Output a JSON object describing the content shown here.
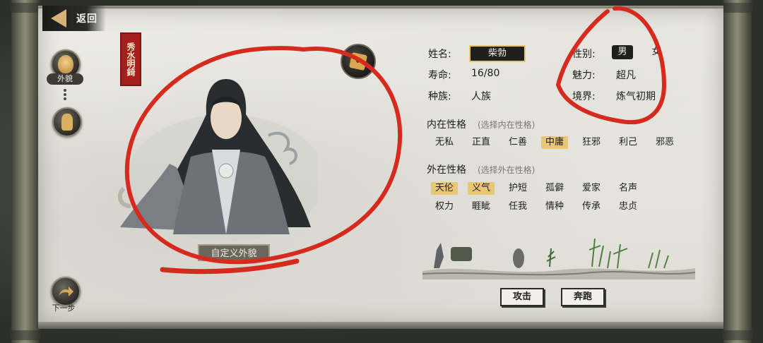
{
  "nav": {
    "back_label": "返回"
  },
  "left_panel": {
    "appearance_label": "外貌",
    "next_label": "下一步"
  },
  "seal_text": "秀水明錡",
  "portrait": {
    "customize_label": "自定义外貌"
  },
  "info": {
    "name_label": "姓名:",
    "name_value": "柴勃",
    "lifespan_label": "寿命:",
    "lifespan_value": "16/80",
    "race_label": "种族:",
    "race_value": "人族",
    "gender_label": "性别:",
    "gender_options": [
      "男",
      "女"
    ],
    "gender_selected": "男",
    "charm_label": "魅力:",
    "charm_value": "超凡",
    "realm_label": "境界:",
    "realm_value": "炼气初期"
  },
  "inner_traits": {
    "title": "内在性格",
    "hint": "(选择内在性格)",
    "options": [
      "无私",
      "正直",
      "仁善",
      "中庸",
      "狂邪",
      "利己",
      "邪恶"
    ],
    "selected": [
      "中庸"
    ]
  },
  "outer_traits": {
    "title": "外在性格",
    "hint": "(选择外在性格)",
    "row1": [
      "天伦",
      "义气",
      "护短",
      "孤僻",
      "爱家",
      "名声"
    ],
    "row2": [
      "权力",
      "睚眦",
      "任我",
      "情种",
      "传承",
      "忠贞"
    ],
    "selected": [
      "天伦",
      "义气"
    ]
  },
  "actions": {
    "attack_label": "攻击",
    "flee_label": "奔跑"
  },
  "colors": {
    "ink_red": "#d62a1e",
    "highlight_gold": "#e9c673",
    "seal_red": "#a5201c",
    "back_arrow": "#d8b278"
  }
}
